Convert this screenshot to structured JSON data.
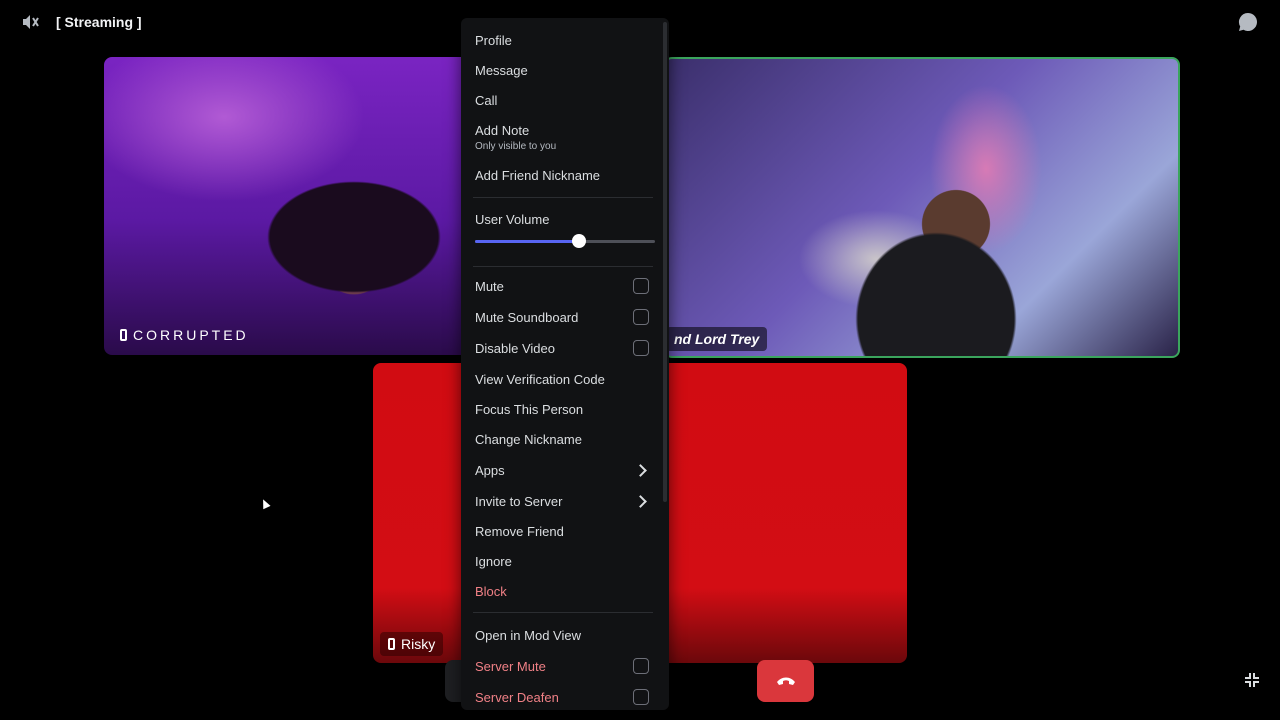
{
  "topbar": {
    "title": "[ Streaming ]",
    "left_icon": "speaker-muted-icon",
    "right_icon": "chat-bubble-icon"
  },
  "tiles": [
    {
      "name": "CORRUPTED",
      "icon": "mobile-phone-icon"
    },
    {
      "name": "nd Lord Trey",
      "speaking": true
    },
    {
      "name": "Risky",
      "icon": "mobile-phone-icon",
      "accent": "#d10c12"
    }
  ],
  "controls": {
    "activity_icon": "activity-icon",
    "more_icon": "more-icon",
    "end_call_icon": "hangup-icon",
    "collapse_icon": "collapse-icon"
  },
  "menu": {
    "profile": "Profile",
    "message": "Message",
    "call": "Call",
    "add_note": "Add Note",
    "add_note_sub": "Only visible to you",
    "add_friend_nickname": "Add Friend Nickname",
    "user_volume": "User Volume",
    "user_volume_value": 0.58,
    "mute": "Mute",
    "mute_soundboard": "Mute Soundboard",
    "disable_video": "Disable Video",
    "view_verification_code": "View Verification Code",
    "focus_this_person": "Focus This Person",
    "change_nickname": "Change Nickname",
    "apps": "Apps",
    "invite_to_server": "Invite to Server",
    "remove_friend": "Remove Friend",
    "ignore": "Ignore",
    "block": "Block",
    "open_in_mod_view": "Open in Mod View",
    "server_mute": "Server Mute",
    "server_deafen": "Server Deafen"
  },
  "colors": {
    "accent": "#5865f2",
    "danger": "#f08086",
    "speaking": "#3ba55d",
    "end_call": "#da373c"
  }
}
